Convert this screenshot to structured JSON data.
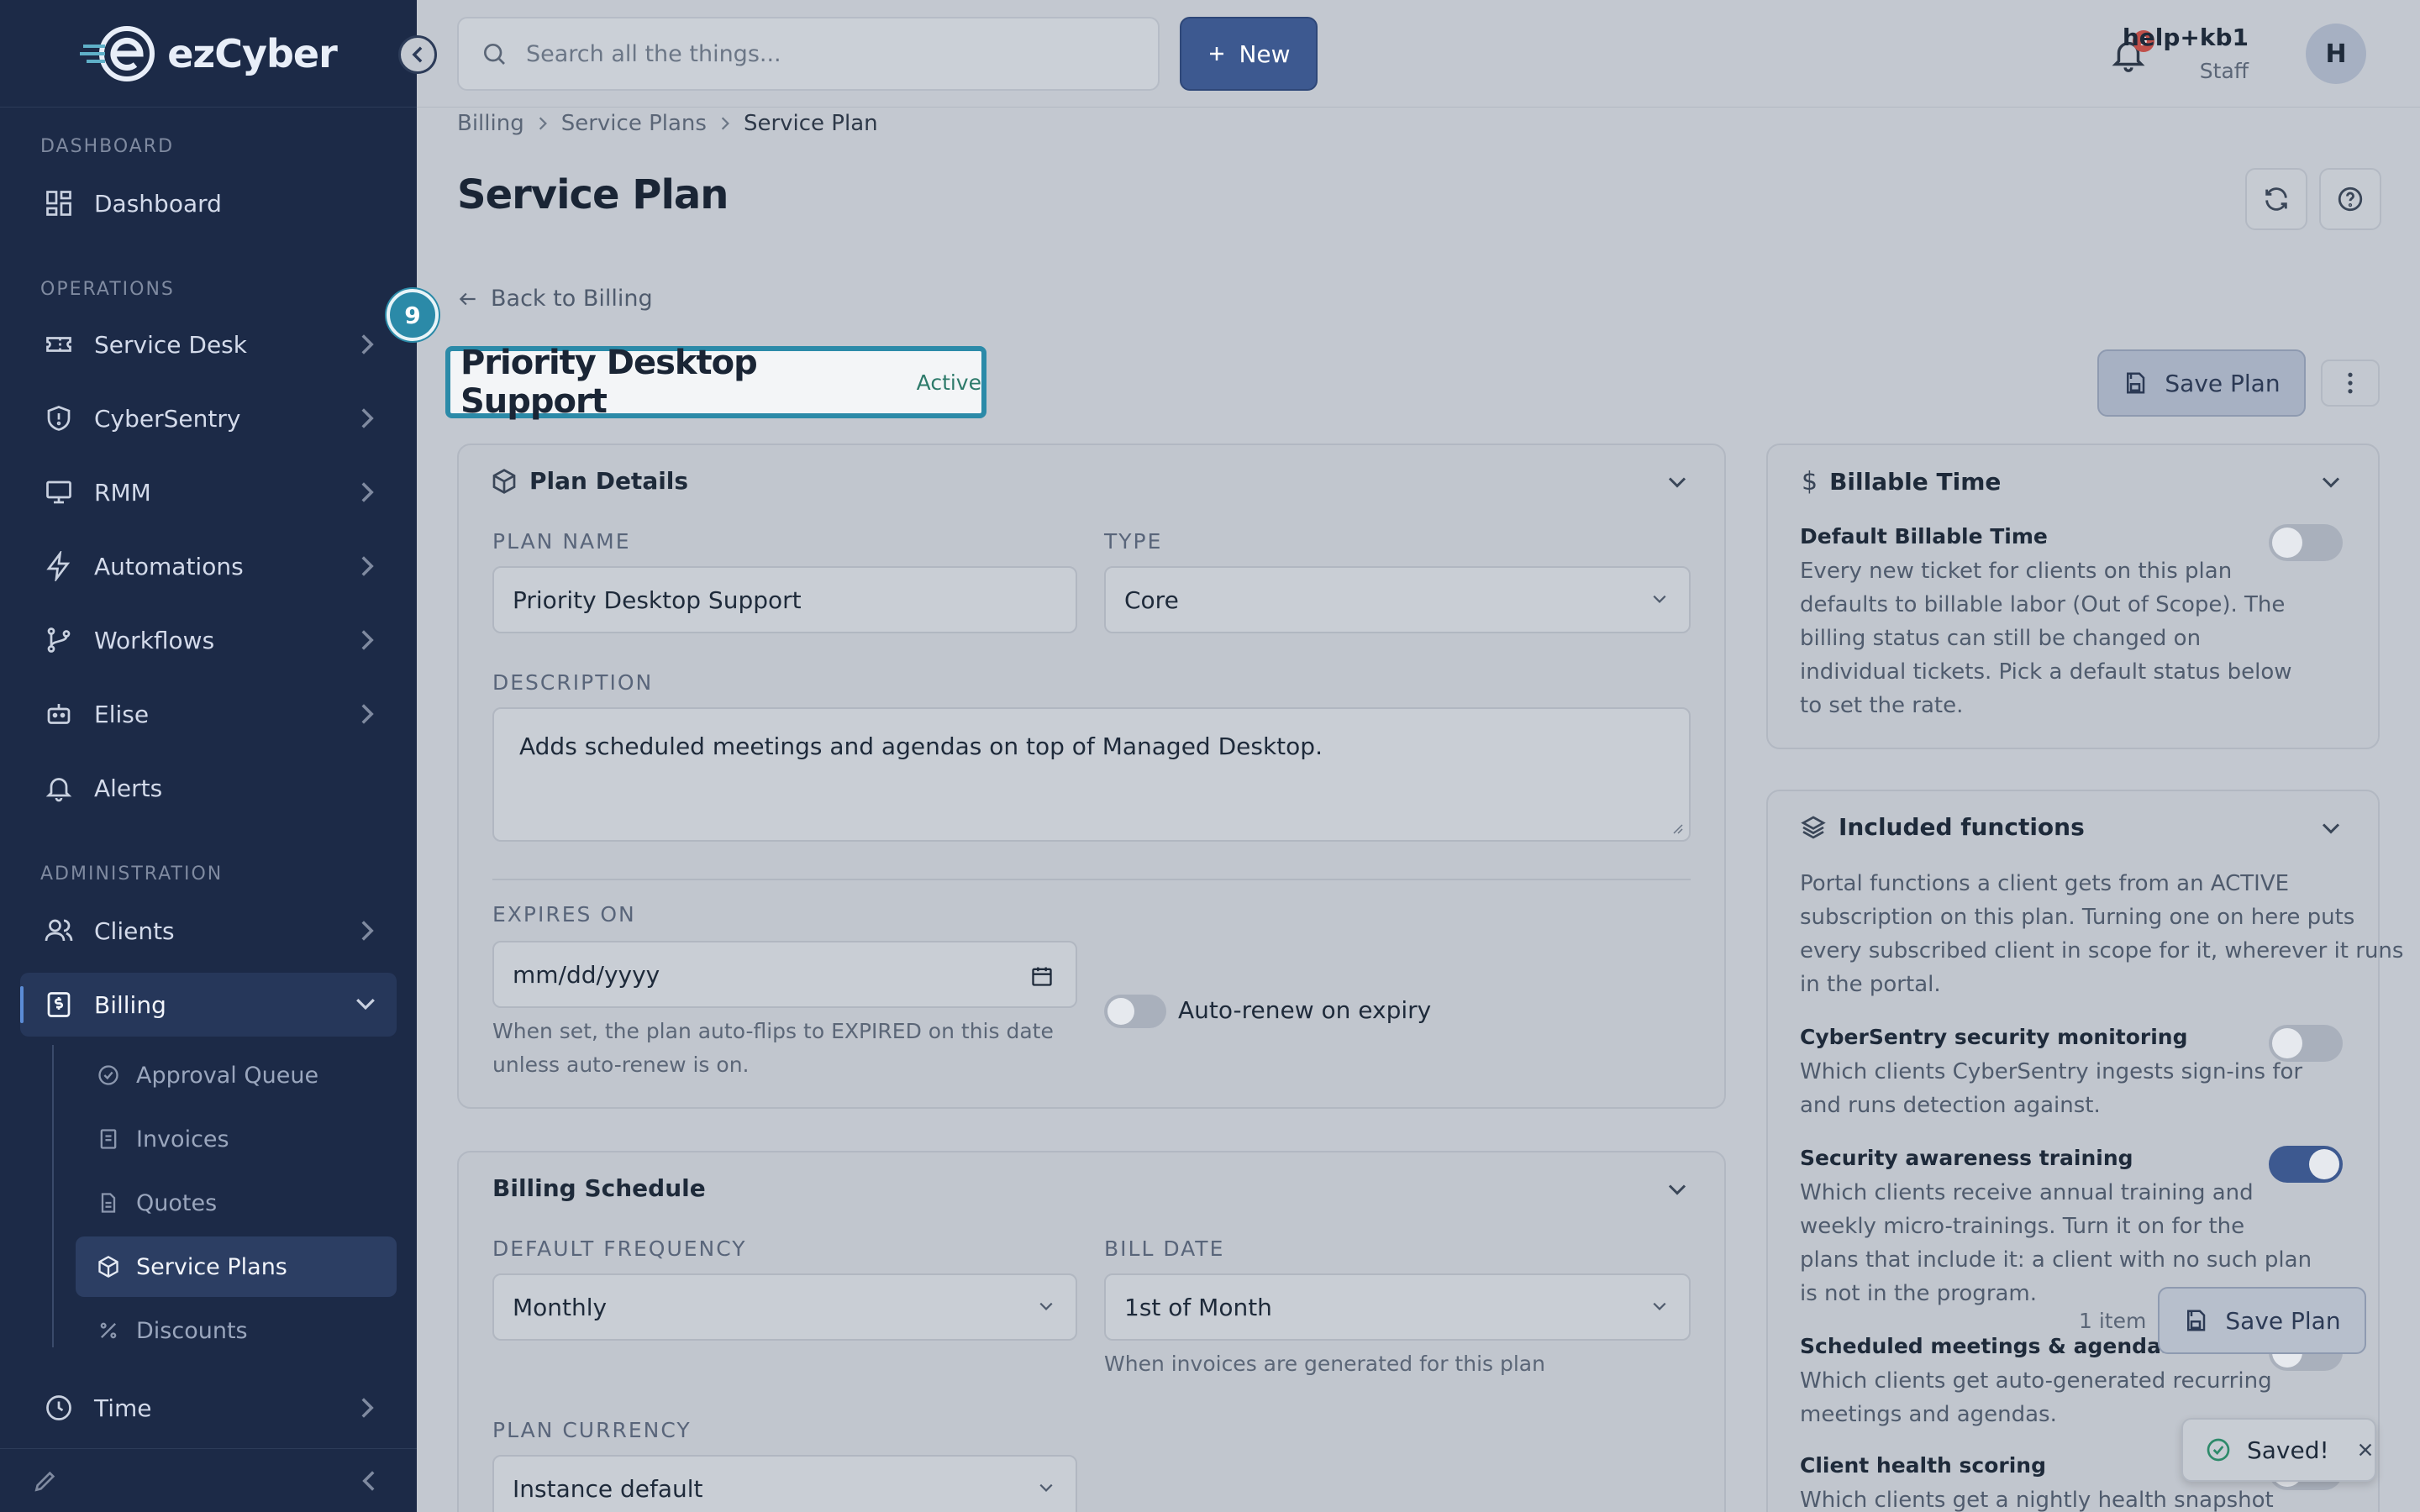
{
  "app": {
    "logo_text": "ezCyber"
  },
  "sidebar": {
    "sections": {
      "dashboard": "DASHBOARD",
      "operations": "OPERATIONS",
      "administration": "ADMINISTRATION"
    },
    "items": [
      {
        "label": "Dashboard",
        "icon": "dashboard-icon"
      },
      {
        "label": "Service Desk",
        "icon": "ticket-icon"
      },
      {
        "label": "CyberSentry",
        "icon": "shield-icon"
      },
      {
        "label": "RMM",
        "icon": "monitor-icon"
      },
      {
        "label": "Automations",
        "icon": "bolt-icon"
      },
      {
        "label": "Workflows",
        "icon": "workflow-icon"
      },
      {
        "label": "Elise",
        "icon": "bot-icon"
      },
      {
        "label": "Alerts",
        "icon": "bell-icon"
      },
      {
        "label": "Clients",
        "icon": "users-icon"
      },
      {
        "label": "Billing",
        "icon": "billing-icon"
      },
      {
        "label": "Time",
        "icon": "clock-icon"
      }
    ],
    "billing_sub": [
      {
        "label": "Approval Queue"
      },
      {
        "label": "Invoices"
      },
      {
        "label": "Quotes"
      },
      {
        "label": "Service Plans"
      },
      {
        "label": "Discounts"
      }
    ]
  },
  "header": {
    "search_placeholder": "Search all the things...",
    "new_label": "New",
    "notification_count": "9",
    "user_name": "help+kb1",
    "user_role": "Staff",
    "avatar_initial": "H"
  },
  "breadcrumb": [
    "Billing",
    "Service Plans",
    "Service Plan"
  ],
  "page": {
    "title": "Service Plan",
    "back_label": "Back to Billing",
    "step_number": "9",
    "plan_name": "Priority Desktop Support",
    "status": "Active",
    "save_label": "Save Plan"
  },
  "plan_details": {
    "title": "Plan Details",
    "plan_name_label": "PLAN NAME",
    "plan_name_value": "Priority Desktop Support",
    "type_label": "TYPE",
    "type_value": "Core",
    "description_label": "DESCRIPTION",
    "description_value": "Adds scheduled meetings and agendas on top of Managed Desktop.",
    "expires_label": "EXPIRES ON",
    "expires_placeholder": "mm/dd/yyyy",
    "expires_help_1": "When set, the plan auto-flips to EXPIRED on this date",
    "expires_help_2": "unless auto-renew is on.",
    "auto_renew_label": "Auto-renew on expiry"
  },
  "billing_schedule": {
    "title": "Billing Schedule",
    "frequency_label": "DEFAULT FREQUENCY",
    "frequency_value": "Monthly",
    "bill_date_label": "BILL DATE",
    "bill_date_value": "1st of Month",
    "bill_date_help": "When invoices are generated for this plan",
    "currency_label": "PLAN CURRENCY",
    "currency_value": "Instance default"
  },
  "billable_time": {
    "title": "Billable Time",
    "default_label": "Default Billable Time",
    "desc_lines": [
      "Every new ticket for clients on this plan",
      "defaults to billable labor (Out of Scope). The",
      "billing status can still be changed on",
      "individual tickets. Pick a default status below",
      "to set the rate."
    ]
  },
  "included_functions": {
    "title": "Included functions",
    "intro_lines": [
      "Portal functions a client gets from an ACTIVE",
      "subscription on this plan. Turning one on here puts",
      "every subscribed client in scope for it, wherever it runs",
      "in the portal."
    ],
    "functions": [
      {
        "title": "CyberSentry security monitoring",
        "lines": [
          "Which clients CyberSentry ingests sign-ins for",
          "and runs detection against."
        ],
        "enabled": false
      },
      {
        "title": "Security awareness training",
        "lines": [
          "Which clients receive annual training and",
          "weekly micro-trainings. Turn it on for the",
          "plans that include it: a client with no such plan",
          "is not in the program."
        ],
        "enabled": true
      },
      {
        "title": "Scheduled meetings & agendas",
        "lines": [
          "Which clients get auto-generated recurring",
          "meetings and agendas."
        ],
        "enabled": false
      },
      {
        "title": "Client health scoring",
        "lines": [
          "Which clients get a nightly health snapshot"
        ],
        "enabled": false
      }
    ]
  },
  "floating": {
    "item_count": "1 item",
    "save_label": "Save Plan"
  },
  "toast": {
    "message": "Saved!"
  }
}
